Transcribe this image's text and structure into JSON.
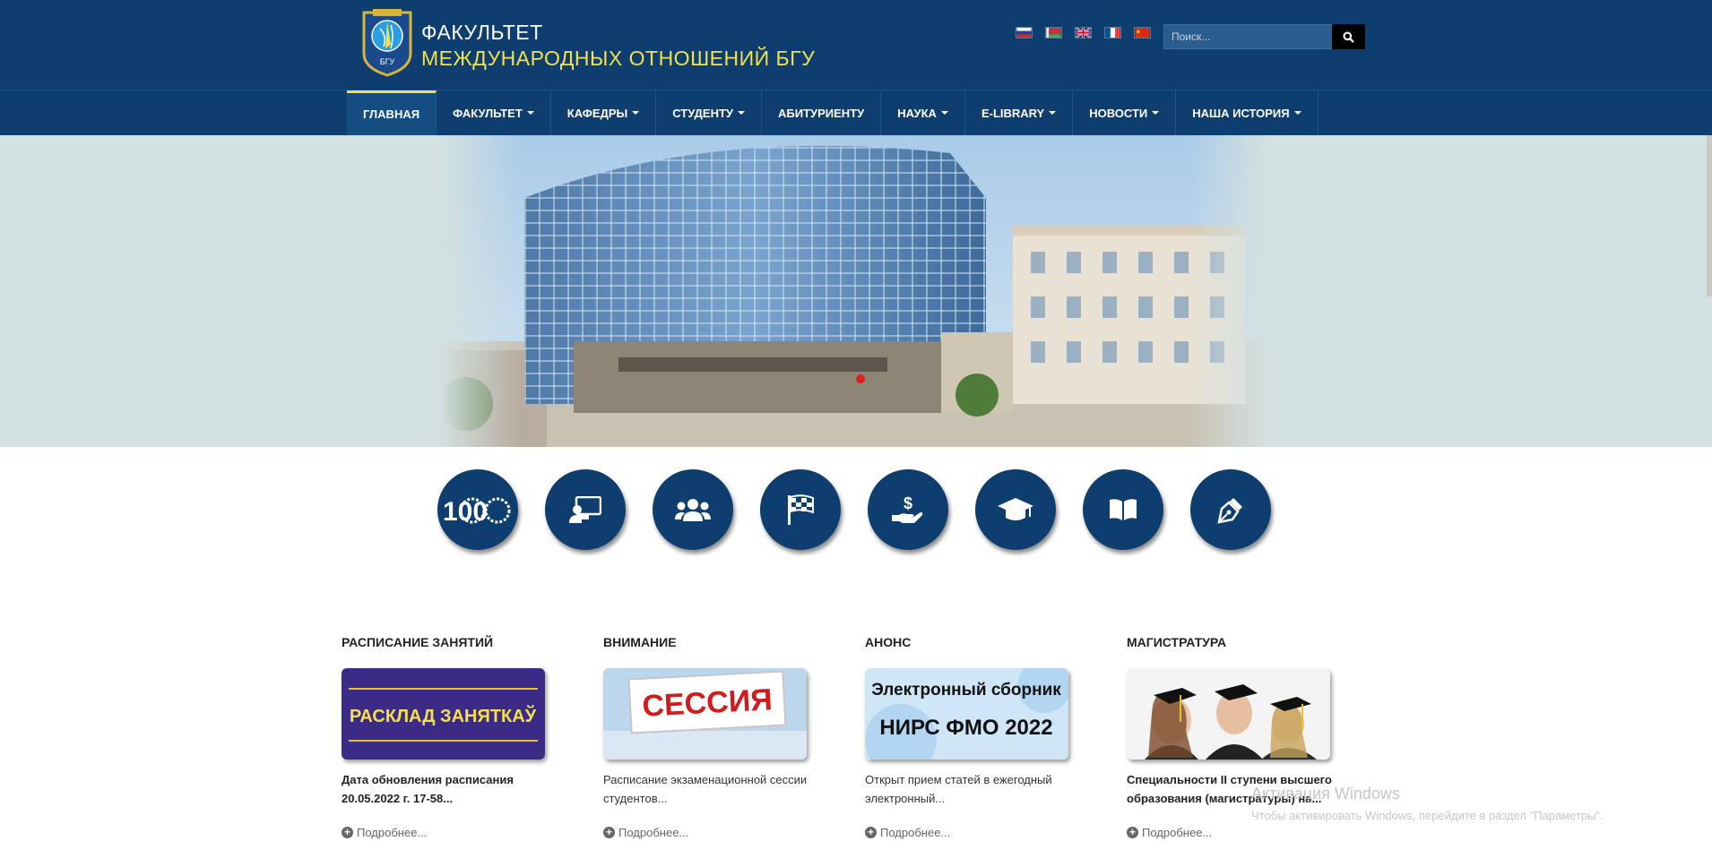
{
  "header": {
    "brand_line1": "ФАКУЛЬТЕТ",
    "brand_line2": "МЕЖДУНАРОДНЫХ ОТНОШЕНИЙ БГУ",
    "crest_text": "БГУ",
    "flags": [
      "flag-russia",
      "flag-belarus",
      "flag-uk",
      "flag-france",
      "flag-china"
    ],
    "search_placeholder": "Поиск..."
  },
  "nav": {
    "items": [
      {
        "label": "ГЛАВНАЯ"
      },
      {
        "label": "ФАКУЛЬТЕТ"
      },
      {
        "label": "КАФЕДРЫ"
      },
      {
        "label": "СТУДЕНТУ"
      },
      {
        "label": "АБИТУРИЕНТУ"
      },
      {
        "label": "НАУКА"
      },
      {
        "label": "E-LIBRARY"
      },
      {
        "label": "НОВОСТИ"
      },
      {
        "label": "НАША ИСТОРИЯ"
      }
    ]
  },
  "icons": [
    {
      "name": "100-anniversary-icon",
      "label": "100"
    },
    {
      "name": "teacher-board-icon"
    },
    {
      "name": "users-group-icon"
    },
    {
      "name": "checkered-flag-icon"
    },
    {
      "name": "hand-dollar-icon"
    },
    {
      "name": "graduation-cap-icon"
    },
    {
      "name": "open-book-icon"
    },
    {
      "name": "pen-nib-icon"
    }
  ],
  "cards": [
    {
      "title": "РАСПИСАНИЕ ЗАНЯТИЙ",
      "image_text": "РАСКЛАД ЗАНЯТКАЎ",
      "text": "Дата обновления расписания 20.05.2022 г. 17-58...",
      "more": "Подробнее..."
    },
    {
      "title": "ВНИМАНИЕ",
      "image_text": "СЕССИЯ",
      "text": "Расписание экзаменационной сессии студентов...",
      "more": "Подробнее..."
    },
    {
      "title": "АНОНС",
      "image_text_1": "Электронный сборник",
      "image_text_2": "НИРС ФМО 2022",
      "text": "Открыт прием статей в ежегодный электронный...",
      "more": "Подробнее..."
    },
    {
      "title": "МАГИСТРАТУРА",
      "text": "Специальности II ступени высшего образования (магистратуры) на...",
      "more": "Подробнее..."
    }
  ],
  "watermark": {
    "line1": "Активация Windows",
    "line2": "Чтобы активировать Windows, перейдите в раздел \"Параметры\"."
  },
  "colors": {
    "header_bg": "#0d3e6f",
    "accent_yellow": "#f4e04d",
    "icon_circle": "#0d3e6f"
  }
}
